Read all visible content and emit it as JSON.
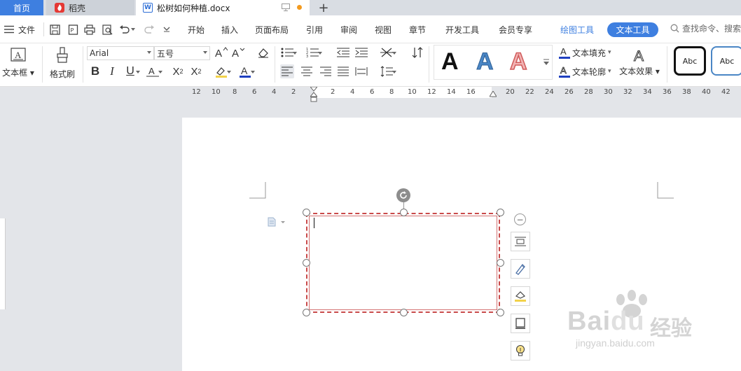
{
  "tabs": {
    "home": "首页",
    "daoke": "稻壳",
    "doc": "松树如何种植.docx"
  },
  "menubar": {
    "file": "文件",
    "items": [
      "开始",
      "插入",
      "页面布局",
      "引用",
      "审阅",
      "视图",
      "章节",
      "开发工具",
      "会员专享"
    ],
    "drawing_tools": "绘图工具",
    "text_tools": "文本工具",
    "search_placeholder": "查找命令、搜索"
  },
  "ribbon": {
    "textbox_label": "文本框",
    "format_painter_label": "格式刷",
    "font_name": "Arial",
    "font_size": "五号",
    "art_letter": "A",
    "text_fill": "文本填充",
    "text_outline": "文本轮廓",
    "text_effect": "文本效果",
    "style_sample_1": "Abc",
    "style_sample_2": "Abc"
  },
  "ruler": {
    "ticks": [
      "12",
      "10",
      "8",
      "6",
      "4",
      "2",
      "2",
      "4",
      "6",
      "8",
      "10",
      "12",
      "14",
      "16",
      "20",
      "22",
      "24",
      "26",
      "28",
      "30",
      "32",
      "34",
      "36",
      "38",
      "40",
      "42"
    ]
  },
  "watermark": {
    "main": "Bai",
    "main2": "du",
    "cn": "经验",
    "url": "jingyan.baidu.com"
  },
  "colors": {
    "accent": "#3e7fe0",
    "textbox_border": "#c94a4a",
    "art_blue": "#4a86c5",
    "art_red": "#e07070"
  }
}
